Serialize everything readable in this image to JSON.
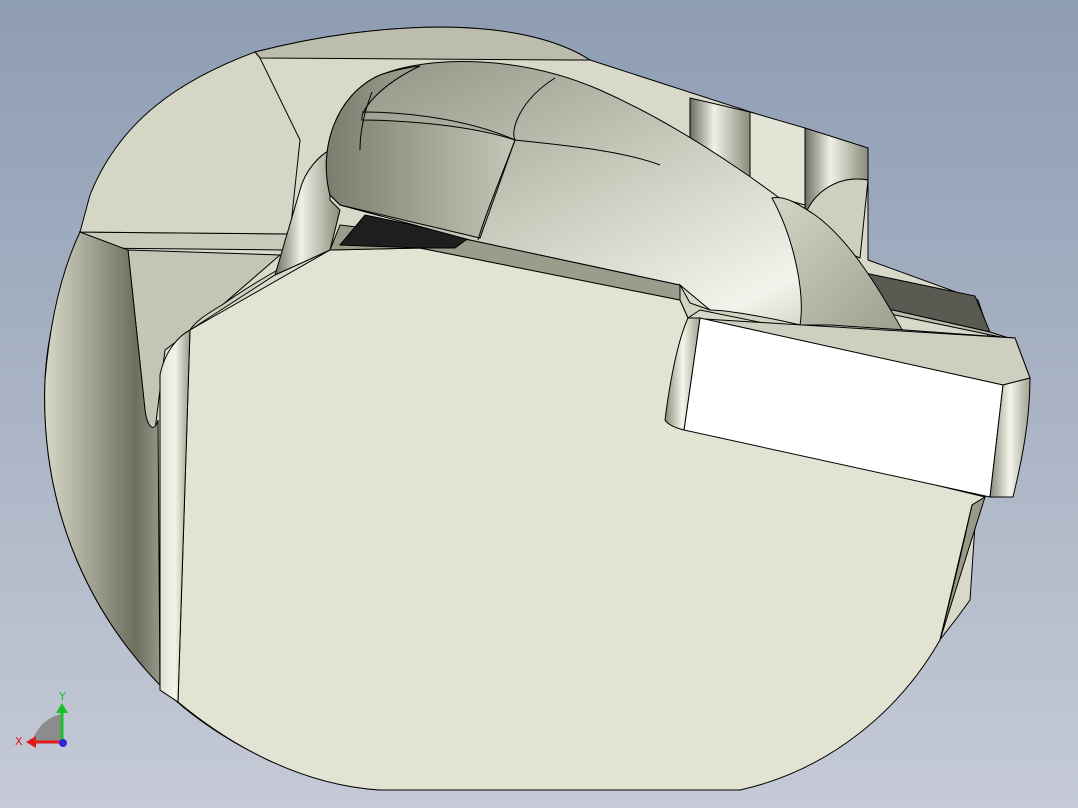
{
  "viewport": {
    "background_top": "#8e9db3",
    "background_bottom": "#c5cad6"
  },
  "model": {
    "face_color": "#e3e3d4",
    "edge_color": "#000000",
    "highlight_face": "#ffffff",
    "shadow_face": "#8a8a78",
    "dark_face": "#1e1e1e"
  },
  "triad": {
    "x_label": "X",
    "y_label": "Y",
    "x_color": "#e21c1c",
    "y_color": "#1fbf2b",
    "z_color": "#2a2ad6"
  }
}
